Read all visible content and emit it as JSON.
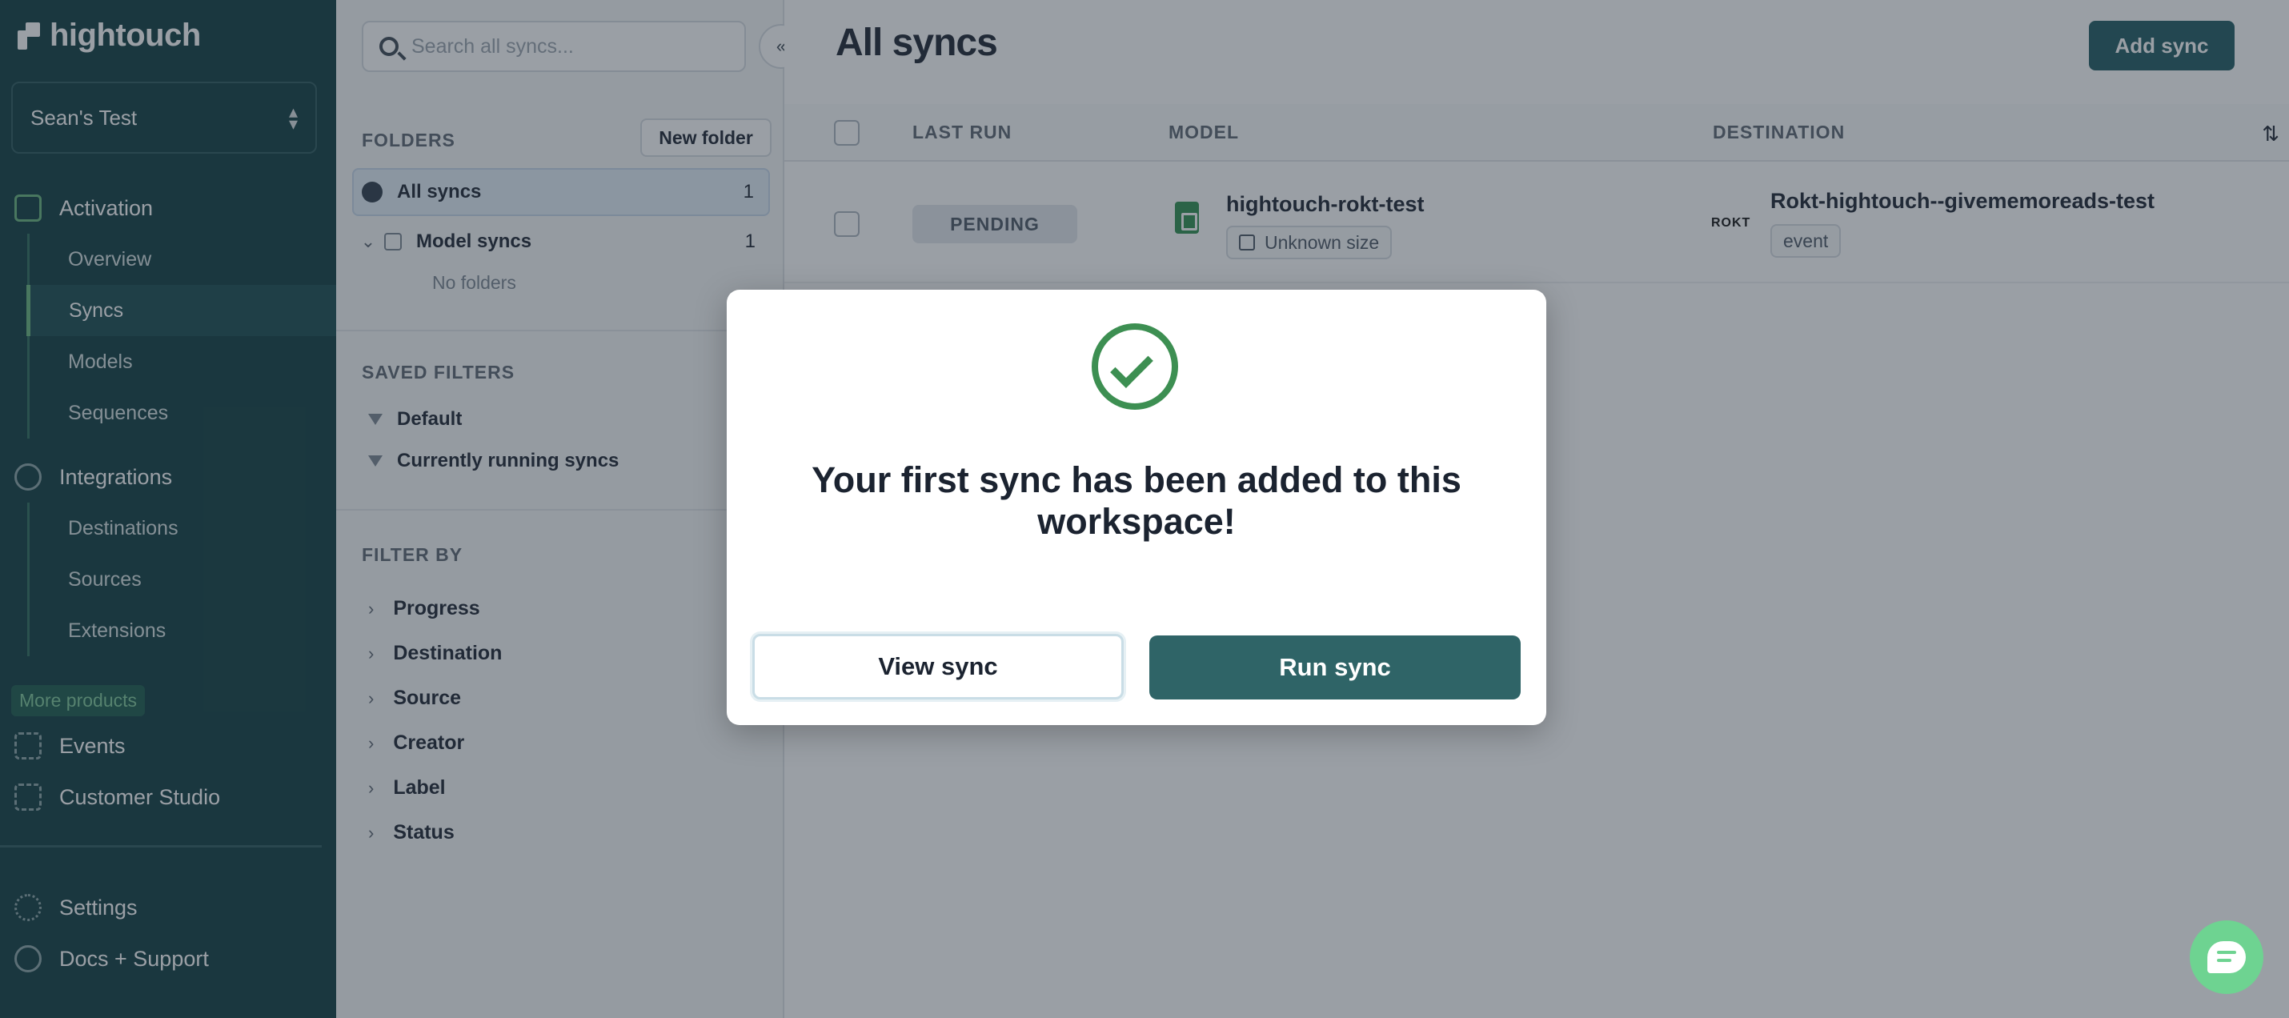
{
  "app": {
    "brand": "hightouch",
    "workspace": "Sean's Test"
  },
  "sidebar": {
    "activation": {
      "label": "Activation",
      "items": [
        {
          "label": "Overview"
        },
        {
          "label": "Syncs",
          "active": true
        },
        {
          "label": "Models"
        },
        {
          "label": "Sequences"
        }
      ]
    },
    "integrations": {
      "label": "Integrations",
      "items": [
        {
          "label": "Destinations"
        },
        {
          "label": "Sources"
        },
        {
          "label": "Extensions"
        }
      ]
    },
    "more_products": "More products",
    "events": "Events",
    "customer_studio": "Customer Studio",
    "settings": "Settings",
    "docs_support": "Docs + Support"
  },
  "filters_panel": {
    "search_placeholder": "Search all syncs...",
    "collapse_icon": "«",
    "folders_label": "FOLDERS",
    "new_folder": "New folder",
    "all_syncs": {
      "label": "All syncs",
      "count": "1"
    },
    "model_syncs": {
      "label": "Model syncs",
      "count": "1"
    },
    "no_folders": "No folders",
    "saved_filters_label": "SAVED FILTERS",
    "saved_filters": [
      "Default",
      "Currently running syncs"
    ],
    "filter_by_label": "FILTER BY",
    "filter_by": [
      "Progress",
      "Destination",
      "Source",
      "Creator",
      "Label",
      "Status"
    ]
  },
  "main": {
    "title": "All syncs",
    "add_sync": "Add sync",
    "columns": {
      "last_run": "LAST RUN",
      "model": "MODEL",
      "destination": "DESTINATION"
    },
    "sort_icon": "⇅",
    "rows": [
      {
        "status": "PENDING",
        "model": "hightouch-rokt-test",
        "model_size": "Unknown size",
        "dest_logo": "ROKT",
        "destination": "Rokt-hightouch--givememoreads-test",
        "dest_tag": "event"
      }
    ]
  },
  "modal": {
    "title": "Your first sync has been added to this workspace!",
    "view_button": "View sync",
    "run_button": "Run sync",
    "icon": "check-circle-icon",
    "accent": "#3d8f52",
    "run_button_color": "#2f6467"
  }
}
